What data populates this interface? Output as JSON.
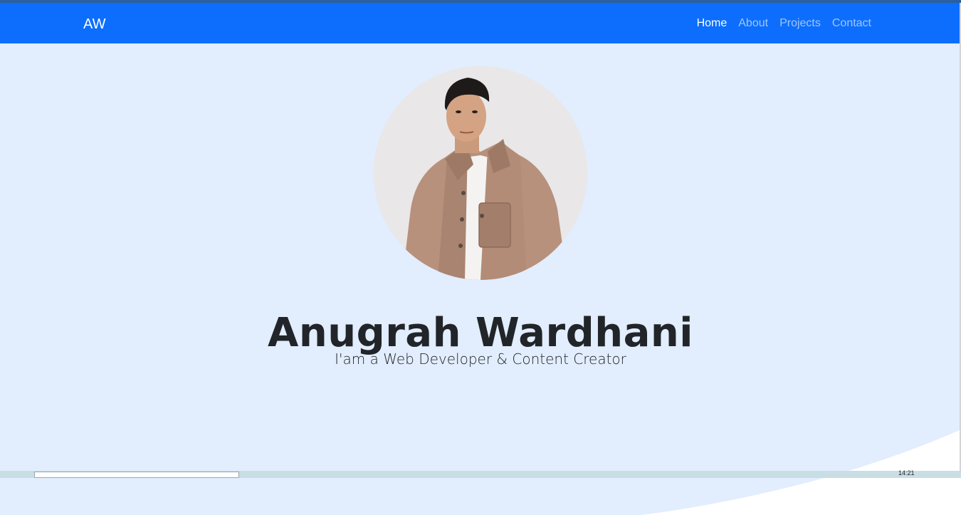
{
  "navbar": {
    "brand": "AW",
    "links": [
      {
        "label": "Home",
        "active": true
      },
      {
        "label": "About",
        "active": false
      },
      {
        "label": "Projects",
        "active": false
      },
      {
        "label": "Contact",
        "active": false
      }
    ]
  },
  "hero": {
    "name": "Anugrah Wardhani",
    "tagline": "I'am a Web Developer & Content Creator",
    "avatar_alt": "profile photo"
  },
  "taskbar": {
    "clock": "14:21"
  },
  "colors": {
    "navbar": "#0d6efd",
    "hero_bg": "#e2edfd",
    "text": "#212529",
    "wave": "#ffffff"
  }
}
